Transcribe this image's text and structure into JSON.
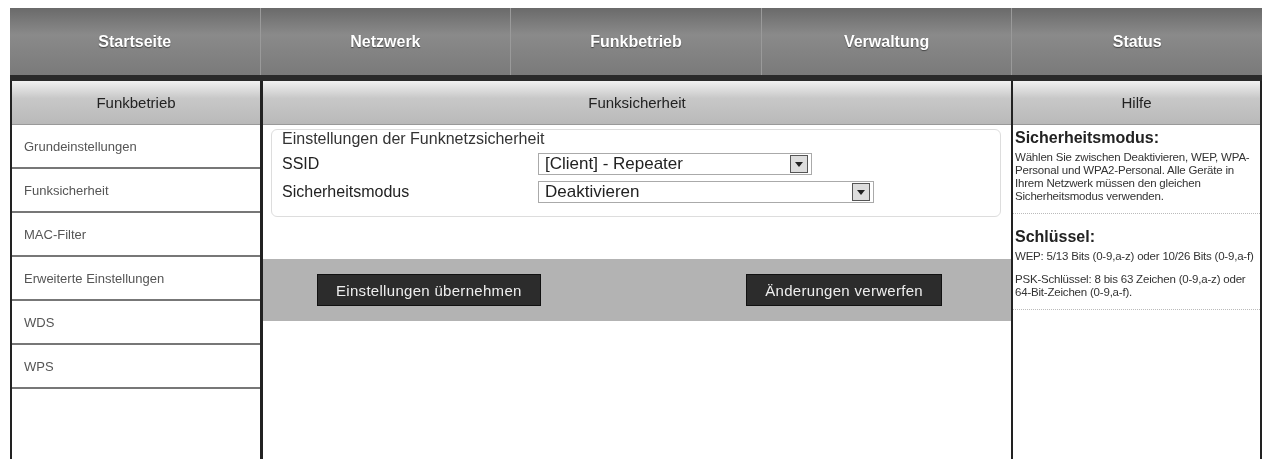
{
  "top_nav": [
    {
      "label": "Startseite"
    },
    {
      "label": "Netzwerk"
    },
    {
      "label": "Funkbetrieb"
    },
    {
      "label": "Verwaltung"
    },
    {
      "label": "Status"
    }
  ],
  "sidebar": {
    "title": "Funkbetrieb",
    "items": [
      {
        "label": "Grundeinstellungen"
      },
      {
        "label": "Funksicherheit"
      },
      {
        "label": "MAC-Filter"
      },
      {
        "label": "Erweiterte Einstellungen"
      },
      {
        "label": "WDS"
      },
      {
        "label": "WPS"
      }
    ]
  },
  "main": {
    "title": "Funksicherheit",
    "group_title": "Einstellungen der Funknetzsicherheit",
    "fields": [
      {
        "label": "SSID",
        "value": "[Client] - Repeater",
        "kind": "short"
      },
      {
        "label": "Sicherheitsmodus",
        "value": "Deaktivieren",
        "kind": "long"
      }
    ],
    "buttons": [
      "Einstellungen übernehmen",
      "Änderungen verwerfen"
    ]
  },
  "help": {
    "title": "Hilfe",
    "sections": [
      {
        "heading": "Sicherheitsmodus:",
        "paragraphs": [
          "Wählen Sie zwischen Deaktivieren, WEP, WPA-Personal und WPA2-Personal. Alle Geräte in Ihrem Netzwerk müssen den gleichen Sicherheitsmodus verwenden."
        ]
      },
      {
        "heading": "Schlüssel:",
        "paragraphs": [
          "WEP: 5/13 Bits (0-9,a-z) oder 10/26 Bits (0-9,a-f)",
          "PSK-Schlüssel: 8 bis 63 Zeichen (0-9,a-z) oder 64-Bit-Zeichen (0-9,a-f)."
        ]
      }
    ]
  }
}
